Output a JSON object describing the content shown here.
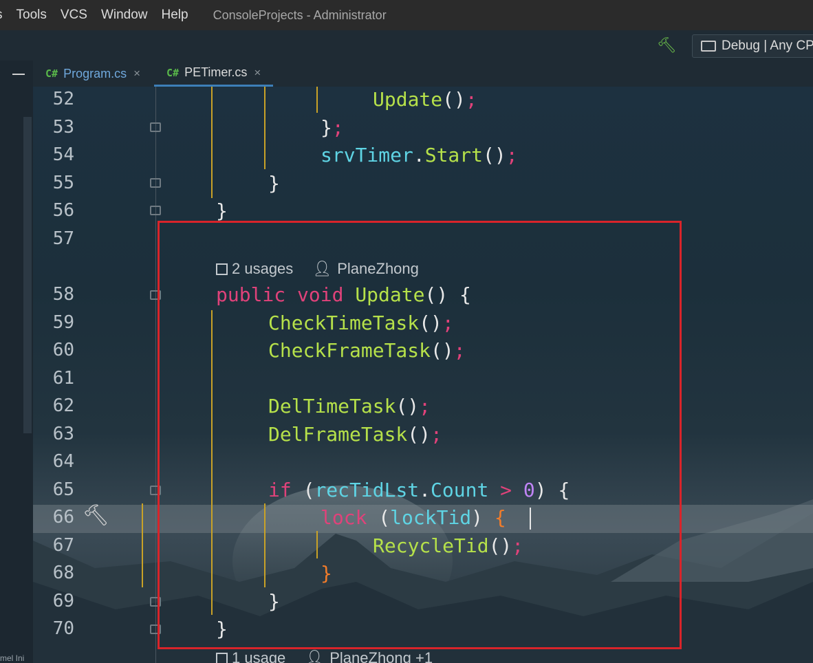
{
  "menu": [
    "s",
    "Tools",
    "VCS",
    "Window",
    "Help"
  ],
  "window_title": "ConsoleProjects - Administrator",
  "toolbar": {
    "config_label": "Debug | Any CP"
  },
  "tabs": [
    {
      "icon": "C#",
      "label": "Program.cs",
      "close": "×"
    },
    {
      "icon": "C#",
      "label": "PETimer.cs",
      "close": "×",
      "active": true
    }
  ],
  "sidebar": {
    "fragment": "mel Ini"
  },
  "editor": {
    "lines": [
      {
        "n": "52"
      },
      {
        "n": "53"
      },
      {
        "n": "54"
      },
      {
        "n": "55"
      },
      {
        "n": "56"
      },
      {
        "n": "57"
      },
      {
        "n": "58"
      },
      {
        "n": "59"
      },
      {
        "n": "60"
      },
      {
        "n": "61"
      },
      {
        "n": "62"
      },
      {
        "n": "63"
      },
      {
        "n": "64"
      },
      {
        "n": "65"
      },
      {
        "n": "66"
      },
      {
        "n": "67"
      },
      {
        "n": "68"
      },
      {
        "n": "69"
      },
      {
        "n": "70"
      }
    ],
    "hint1": {
      "usages": "2 usages",
      "author": "PlaneZhong"
    },
    "hint2": {
      "usages": "1 usage",
      "author": "PlaneZhong +1"
    },
    "tokens": {
      "l52": [
        "Update",
        "()",
        ";"
      ],
      "l53": [
        "}",
        ";"
      ],
      "l54": [
        "srvTimer",
        ".",
        "Start",
        "()",
        ";"
      ],
      "l55": [
        "}"
      ],
      "l56": [
        "}"
      ],
      "l58": [
        "public",
        "void",
        "Update",
        "()",
        "{"
      ],
      "l59": [
        "CheckTimeTask",
        "()",
        ";"
      ],
      "l60": [
        "CheckFrameTask",
        "()",
        ";"
      ],
      "l62": [
        "DelTimeTask",
        "()",
        ";"
      ],
      "l63": [
        "DelFrameTask",
        "()",
        ";"
      ],
      "l65": [
        "if",
        "(",
        "recTidLst",
        ".",
        "Count",
        ">",
        "0",
        ")",
        "{"
      ],
      "l66": [
        "lock",
        "(",
        "lockTid",
        ")",
        "{"
      ],
      "l67": [
        "RecycleTid",
        "()",
        ";"
      ],
      "l68": [
        "}"
      ],
      "l69": [
        "}"
      ],
      "l70": [
        "}"
      ]
    }
  },
  "colors": {
    "keyword": "#e0427a",
    "method": "#b6e14a",
    "identifier": "#5fd4e4",
    "number": "#c084f5",
    "highlight_box": "#d9242a",
    "guide": "#c9a227"
  }
}
